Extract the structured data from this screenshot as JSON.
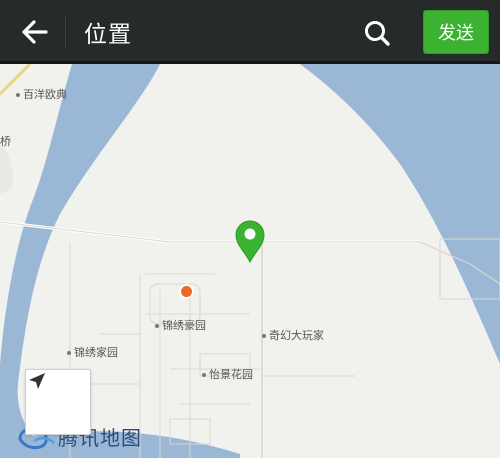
{
  "header": {
    "title": "位置",
    "send_label": "发送"
  },
  "map": {
    "pois": [
      {
        "label": "百洋欧典"
      },
      {
        "label": "桥"
      },
      {
        "label": "锦绣豪园"
      },
      {
        "label": "奇幻大玩家"
      },
      {
        "label": "锦绣家园"
      },
      {
        "label": "怡景花园"
      }
    ],
    "logo_text": "腾讯地图"
  },
  "colors": {
    "header_bg": "#262a2b",
    "send_button": "#3cb233",
    "water": "#9ab8d6",
    "pin": "#3cb233",
    "current_location": "#e8692a"
  }
}
